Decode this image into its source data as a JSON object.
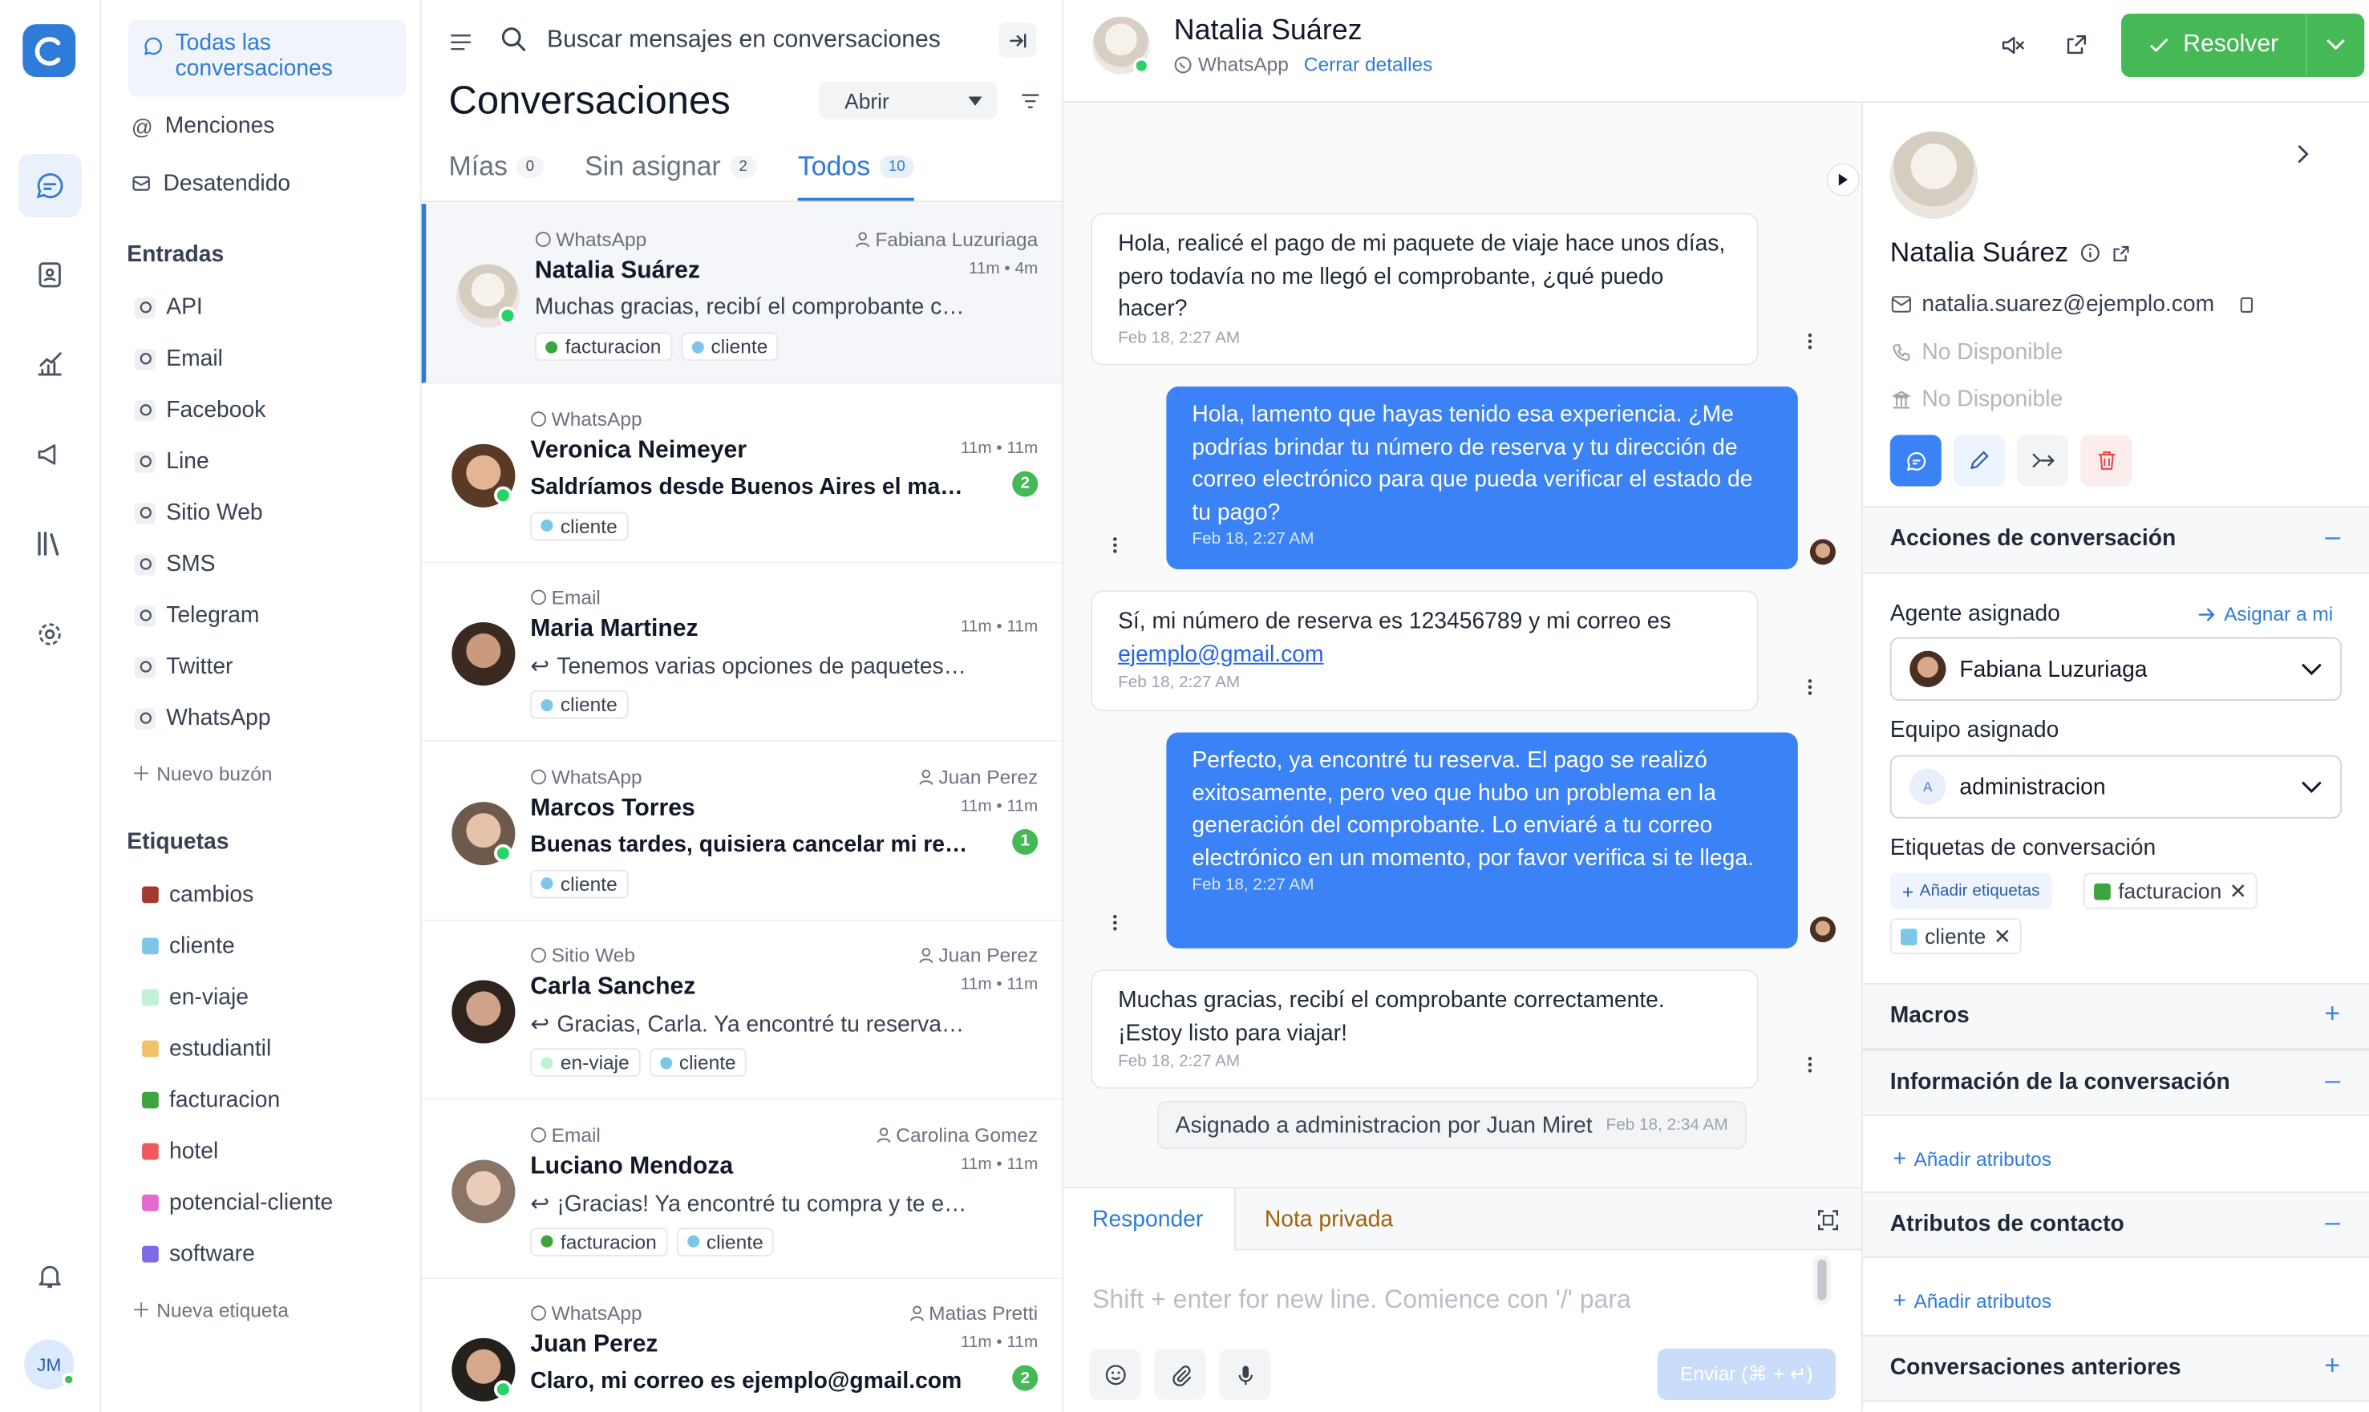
{
  "colors": {
    "accent": "#3b82f6",
    "resolve": "#44b956",
    "whatsapp": "#25d366",
    "danger": "#ef4444"
  },
  "rail": {
    "user_initials": "JM",
    "icons": [
      "logo-icon",
      "chat-icon",
      "contacts-icon",
      "reports-icon",
      "campaigns-icon",
      "library-icon",
      "settings-icon",
      "bell-icon"
    ]
  },
  "sidebar": {
    "all_conversations": "Todas las conversaciones",
    "mentions": "Menciones",
    "unattended": "Desatendido",
    "inboxes_title": "Entradas",
    "inboxes": [
      {
        "label": "API",
        "icon": "cloud-icon"
      },
      {
        "label": "Email",
        "icon": "mail-icon"
      },
      {
        "label": "Facebook",
        "icon": "facebook-icon"
      },
      {
        "label": "Line",
        "icon": "line-icon"
      },
      {
        "label": "Sitio Web",
        "icon": "globe-icon"
      },
      {
        "label": "SMS",
        "icon": "sms-icon"
      },
      {
        "label": "Telegram",
        "icon": "telegram-icon"
      },
      {
        "label": "Twitter",
        "icon": "twitter-icon"
      },
      {
        "label": "WhatsApp",
        "icon": "whatsapp-icon"
      }
    ],
    "new_inbox": "Nuevo buzón",
    "labels_title": "Etiquetas",
    "labels": [
      {
        "label": "cambios",
        "color": "#a23a2f"
      },
      {
        "label": "cliente",
        "color": "#7cc7e8"
      },
      {
        "label": "en-viaje",
        "color": "#bff2d5"
      },
      {
        "label": "estudiantil",
        "color": "#f0c36a"
      },
      {
        "label": "facturacion",
        "color": "#3da53d"
      },
      {
        "label": "hotel",
        "color": "#ef5b5b"
      },
      {
        "label": "potencial-cliente",
        "color": "#e36ad0"
      },
      {
        "label": "software",
        "color": "#7d6ae6"
      }
    ],
    "new_label": "Nueva etiqueta"
  },
  "list": {
    "search_placeholder": "Buscar mensajes en conversaciones",
    "title": "Conversaciones",
    "status_filter": "Abrir",
    "tabs": [
      {
        "label": "Mías",
        "count": "0"
      },
      {
        "label": "Sin asignar",
        "count": "2"
      },
      {
        "label": "Todos",
        "count": "10"
      }
    ],
    "conversations": [
      {
        "channel": "WhatsApp",
        "agent": "Fabiana Luzuriaga",
        "name": "Natalia Suárez",
        "time": "11m • 4m",
        "preview": "Muchas gracias, recibí el comprobante correctamente. ¡Estoy listo para viajar!",
        "unread": "",
        "labels": [
          {
            "t": "facturacion",
            "c": "#3da53d"
          },
          {
            "t": "cliente",
            "c": "#7cc7e8"
          }
        ]
      },
      {
        "channel": "WhatsApp",
        "agent": "",
        "name": "Veronica Neimeyer",
        "time": "11m • 11m",
        "preview": "Saldríamos desde Buenos Aires el martes",
        "unread": "2",
        "labels": [
          {
            "t": "cliente",
            "c": "#7cc7e8"
          }
        ]
      },
      {
        "channel": "Email",
        "agent": "",
        "name": "Maria Martinez",
        "time": "11m • 11m",
        "preview": "Tenemos varias opciones de paquetes disponibles",
        "unread": "",
        "labels": [
          {
            "t": "cliente",
            "c": "#7cc7e8"
          }
        ]
      },
      {
        "channel": "WhatsApp",
        "agent": "Juan Perez",
        "name": "Marcos Torres",
        "time": "11m • 11m",
        "preview": "Buenas tardes, quisiera cancelar mi reserva",
        "unread": "1",
        "labels": [
          {
            "t": "cliente",
            "c": "#7cc7e8"
          }
        ]
      },
      {
        "channel": "Sitio Web",
        "agent": "Juan Perez",
        "name": "Carla Sanchez",
        "time": "11m • 11m",
        "preview": "Gracias, Carla. Ya encontré tu reserva en el sistema",
        "unread": "",
        "labels": [
          {
            "t": "en-viaje",
            "c": "#bff2d5"
          },
          {
            "t": "cliente",
            "c": "#7cc7e8"
          }
        ]
      },
      {
        "channel": "Email",
        "agent": "Carolina Gomez",
        "name": "Luciano Mendoza",
        "time": "11m • 11m",
        "preview": "¡Gracias! Ya encontré tu compra y te envío los detalles",
        "unread": "",
        "labels": [
          {
            "t": "facturacion",
            "c": "#3da53d"
          },
          {
            "t": "cliente",
            "c": "#7cc7e8"
          }
        ]
      },
      {
        "channel": "WhatsApp",
        "agent": "Matias Pretti",
        "name": "Juan Perez",
        "time": "11m • 11m",
        "preview": "Claro, mi correo es ejemplo@gmail.com",
        "unread": "2",
        "labels": []
      }
    ]
  },
  "chat": {
    "contact_name": "Natalia Suárez",
    "channel": "WhatsApp",
    "close_details": "Cerrar detalles",
    "resolve_label": "Resolver",
    "messages": [
      {
        "text": "Hola, realicé el pago de mi paquete de viaje hace unos días, pero todavía no me llegó el comprobante, ¿qué puedo hacer?",
        "time": "Feb 18, 2:27 AM"
      },
      {
        "text": "Hola, lamento que hayas tenido esa experiencia. ¿Me podrías brindar tu número de reserva y tu dirección de correo electrónico para que pueda verificar el estado de tu pago?",
        "time": "Feb 18, 2:27 AM"
      },
      {
        "text": "Sí, mi número de reserva es 123456789 y mi correo es",
        "link": "ejemplo@gmail.com",
        "time": "Feb 18, 2:27 AM"
      },
      {
        "text": "Perfecto, ya encontré tu reserva. El pago se realizó exitosamente, pero veo que hubo un problema en la generación del comprobante. Lo enviaré a tu correo electrónico en un momento, por favor verifica si te llega.",
        "time": "Feb 18, 2:27 AM"
      },
      {
        "text": "Muchas gracias, recibí el comprobante correctamente. ¡Estoy listo para viajar!",
        "time": "Feb 18, 2:27 AM"
      }
    ],
    "activity": {
      "text": "Asignado a administracion por Juan Miret",
      "time": "Feb 18, 2:34 AM"
    },
    "composer": {
      "reply_tab": "Responder",
      "private_tab": "Nota privada",
      "placeholder": "Shift + enter for new line. Comience con '/' para",
      "send_label": "Enviar (⌘ + ↵)"
    }
  },
  "panel": {
    "name": "Natalia Suárez",
    "email": "natalia.suarez@ejemplo.com",
    "phone": "No Disponible",
    "company": "No Disponible",
    "actions_title": "Acciones de conversación",
    "agent_label": "Agente asignado",
    "assign_to_me": "Asignar a mi",
    "agent_value": "Fabiana Luzuriaga",
    "team_label": "Equipo asignado",
    "team_initial": "A",
    "team_value": "administracion",
    "tags_label": "Etiquetas de conversación",
    "add_tags": "Añadir etiquetas",
    "tags": [
      {
        "t": "facturacion",
        "c": "#3da53d"
      },
      {
        "t": "cliente",
        "c": "#7cc7e8"
      }
    ],
    "macros_title": "Macros",
    "info_title": "Información de la conversación",
    "add_attributes": "Añadir atributos",
    "contact_attrs_title": "Atributos de contacto",
    "add_attributes_2": "Añadir atributos",
    "previous_title": "Conversaciones anteriores"
  }
}
